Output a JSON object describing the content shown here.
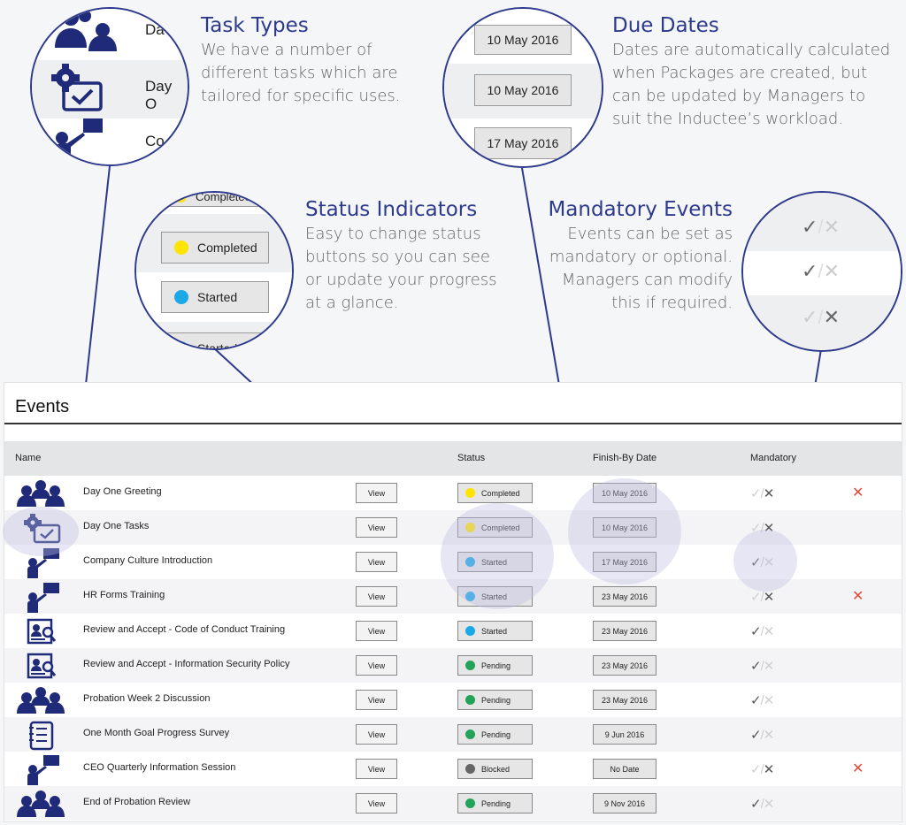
{
  "colors": {
    "accent": "#2d3a8c",
    "completed": "#ffe400",
    "started": "#1aa8e6",
    "pending": "#23a35a",
    "blocked": "#666666",
    "delete": "#e04a3a"
  },
  "callouts": {
    "task_types": {
      "title": "Task Types",
      "lines": [
        "We have a number of",
        "different tasks which are",
        "tailored for specific uses."
      ]
    },
    "due_dates": {
      "title": "Due Dates",
      "lines": [
        "Dates are automatically calculated",
        "when Packages are created, but",
        "can be updated by Managers to",
        "suit the Inductee’s workload."
      ]
    },
    "status": {
      "title": "Status Indicators",
      "lines": [
        "Easy to change status",
        "buttons so you can see",
        "or update your progress",
        "at a glance."
      ]
    },
    "mandatory": {
      "title": "Mandatory Events",
      "lines": [
        "Events can be set as",
        "mandatory or optional.",
        "Managers can modify",
        "this if required."
      ]
    }
  },
  "lens_task": {
    "items": [
      "Da",
      "Day O",
      "Co"
    ],
    "icons": [
      "group-icon",
      "task-icon",
      "presenter-icon"
    ]
  },
  "lens_dates": {
    "items": [
      "10 May 2016",
      "10 May 2016",
      "17 May 2016"
    ]
  },
  "lens_status": {
    "items": [
      "Completed",
      "Completed",
      "Started",
      "Started"
    ]
  },
  "lens_mandatory": {
    "marks": [
      "✓",
      "/",
      "✕"
    ]
  },
  "panel": {
    "title": "Events",
    "columns": {
      "name": "Name",
      "status": "Status",
      "date": "Finish-By Date",
      "mandatory": "Mandatory"
    },
    "view_label": "View",
    "check_glyph": "✓",
    "slash_glyph": "/",
    "cross_glyph": "✕",
    "delete_glyph": "✕"
  },
  "rows": [
    {
      "name": "Day One Greeting",
      "icon": "group-icon",
      "status": "Completed",
      "status_color": "#ffe400",
      "date": "10 May 2016",
      "mandatory": false,
      "deletable": true
    },
    {
      "name": "Day One Tasks",
      "icon": "task-icon",
      "status": "Completed",
      "status_color": "#ffe400",
      "date": "10 May 2016",
      "mandatory": false,
      "deletable": false
    },
    {
      "name": "Company Culture Introduction",
      "icon": "presenter-icon",
      "status": "Started",
      "status_color": "#1aa8e6",
      "date": "17 May 2016",
      "mandatory": true,
      "deletable": false
    },
    {
      "name": "HR Forms Training",
      "icon": "presenter-icon",
      "status": "Started",
      "status_color": "#1aa8e6",
      "date": "23 May 2016",
      "mandatory": false,
      "deletable": true
    },
    {
      "name": "Review and Accept - Code of Conduct Training",
      "icon": "review-icon",
      "status": "Started",
      "status_color": "#1aa8e6",
      "date": "23 May 2016",
      "mandatory": true,
      "deletable": false
    },
    {
      "name": "Review and Accept - Information Security Policy",
      "icon": "review-icon",
      "status": "Pending",
      "status_color": "#23a35a",
      "date": "23 May 2016",
      "mandatory": true,
      "deletable": false
    },
    {
      "name": "Probation Week 2 Discussion",
      "icon": "group-icon",
      "status": "Pending",
      "status_color": "#23a35a",
      "date": "23 May 2016",
      "mandatory": true,
      "deletable": false
    },
    {
      "name": "One Month Goal Progress Survey",
      "icon": "survey-icon",
      "status": "Pending",
      "status_color": "#23a35a",
      "date": "9 Jun 2016",
      "mandatory": true,
      "deletable": false
    },
    {
      "name": "CEO Quarterly Information Session",
      "icon": "presenter-icon",
      "status": "Blocked",
      "status_color": "#666666",
      "date": "No Date",
      "mandatory": false,
      "deletable": true
    },
    {
      "name": "End of Probation Review",
      "icon": "group-icon",
      "status": "Pending",
      "status_color": "#23a35a",
      "date": "9 Nov 2016",
      "mandatory": true,
      "deletable": false
    }
  ]
}
